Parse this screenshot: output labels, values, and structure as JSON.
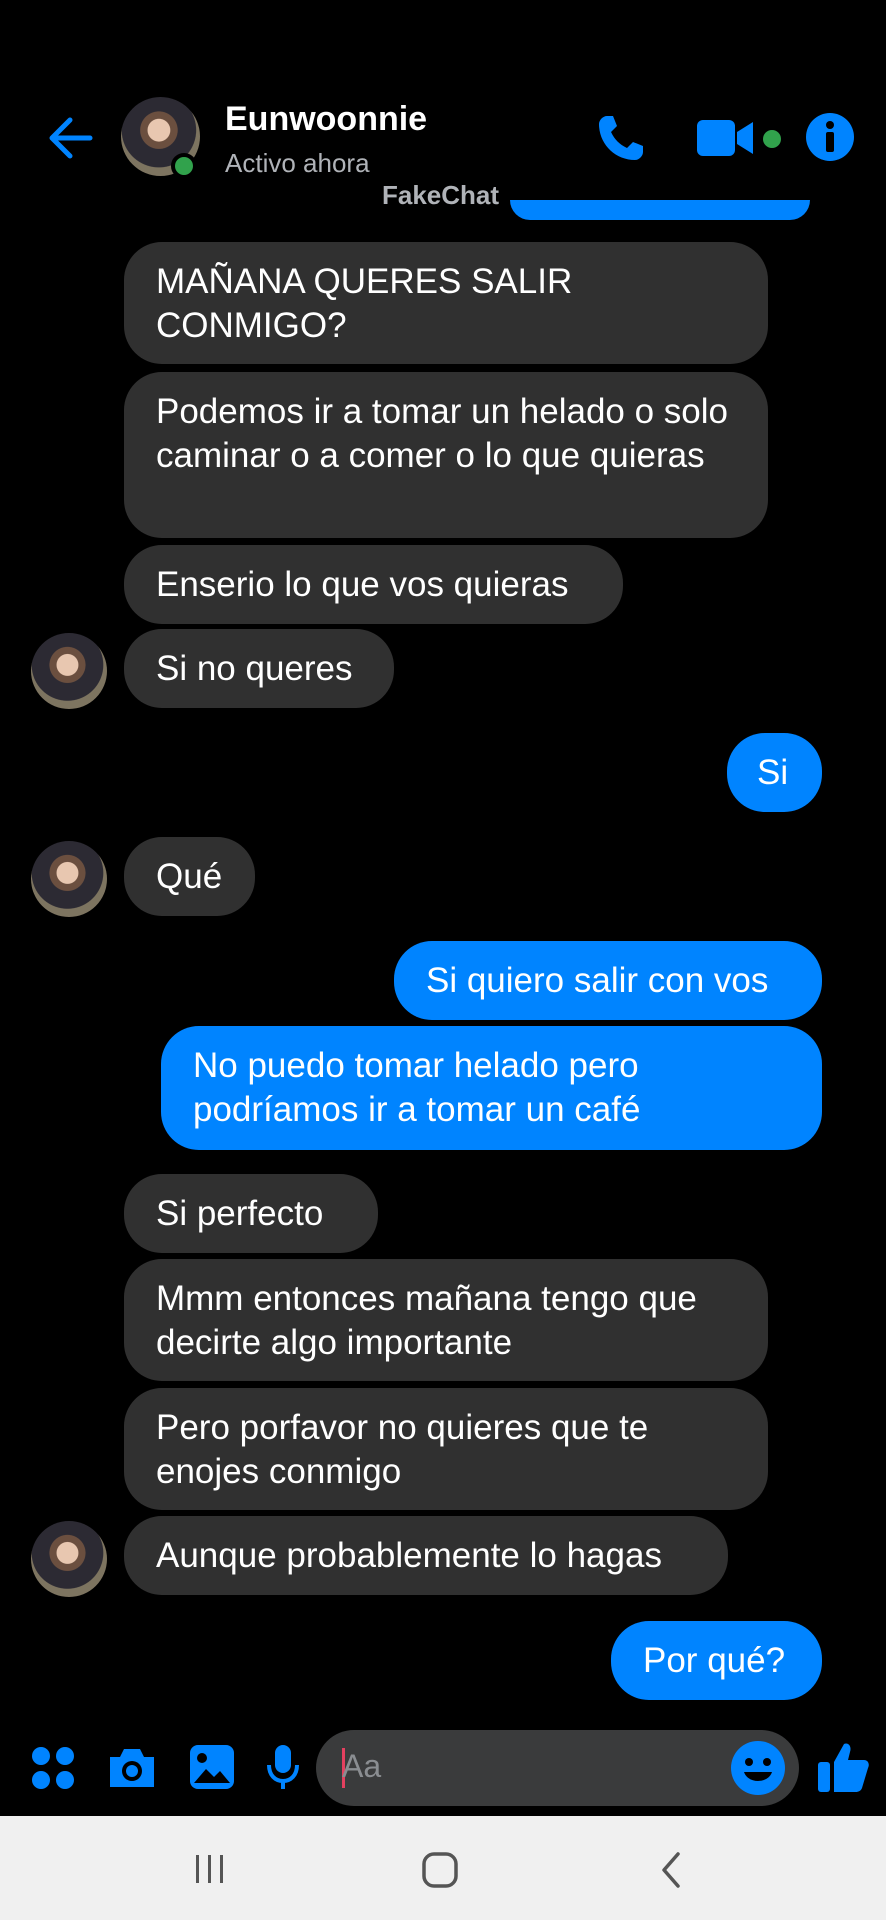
{
  "header": {
    "contact_name": "Eunwoonnie",
    "status": "Activo ahora",
    "watermark": "FakeChat"
  },
  "messages": [
    {
      "from": "contact",
      "text": "MAÑANA QUERES SALIR CONMIGO?"
    },
    {
      "from": "contact",
      "text": "Podemos ir a tomar un helado o solo caminar o a comer o lo que quieras"
    },
    {
      "from": "contact",
      "text": "Enserio lo que vos quieras"
    },
    {
      "from": "contact",
      "text": "Si no queres"
    },
    {
      "from": "me",
      "text": "Si"
    },
    {
      "from": "contact",
      "text": "Qué"
    },
    {
      "from": "me",
      "text": "Si quiero salir con vos"
    },
    {
      "from": "me",
      "text": "No puedo tomar helado pero podríamos ir a tomar un café"
    },
    {
      "from": "contact",
      "text": "Si perfecto"
    },
    {
      "from": "contact",
      "text": "Mmm entonces mañana tengo que decirte algo importante"
    },
    {
      "from": "contact",
      "text": "Pero porfavor no quieres que te enojes conmigo"
    },
    {
      "from": "contact",
      "text": "Aunque probablemente lo hagas"
    },
    {
      "from": "me",
      "text": "Por qué?"
    }
  ],
  "composer": {
    "placeholder": "Aa"
  },
  "colors": {
    "accent": "#0084ff",
    "incoming_bubble": "#303030",
    "online": "#31a24c"
  },
  "icons": {
    "back": "arrow-left-icon",
    "call": "phone-icon",
    "video": "video-camera-icon",
    "info": "info-icon",
    "apps": "four-dots-icon",
    "camera": "camera-icon",
    "gallery": "image-icon",
    "mic": "microphone-icon",
    "emoji": "smiley-icon",
    "like": "thumbs-up-icon"
  }
}
